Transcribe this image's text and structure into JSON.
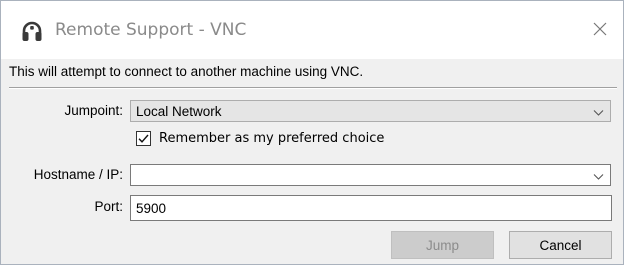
{
  "window": {
    "title": "Remote Support - VNC",
    "icon": "headset-icon"
  },
  "intro_text": "This will attempt to connect to another machine using VNC.",
  "form": {
    "jumpoint_label": "Jumpoint:",
    "jumpoint_value": "Local Network",
    "remember_label": "Remember as my preferred choice",
    "remember_checked": true,
    "hostname_label": "Hostname / IP:",
    "hostname_value": "",
    "port_label": "Port:",
    "port_value": "5900"
  },
  "buttons": {
    "jump_label": "Jump",
    "jump_enabled": false,
    "cancel_label": "Cancel"
  },
  "colors": {
    "title_text": "#8a8a8a",
    "disabled_button": "#cccccc",
    "dialog_background": "#f0f0f0"
  }
}
